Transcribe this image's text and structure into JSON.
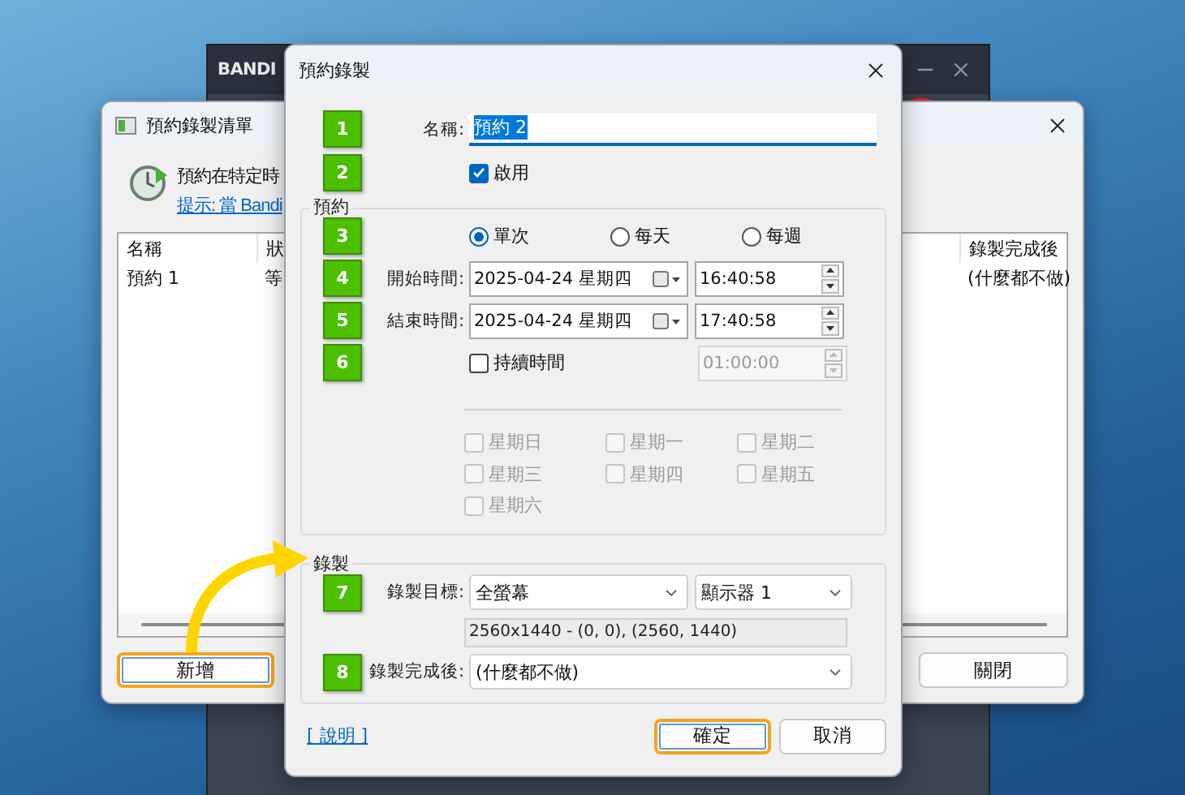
{
  "background_app": {
    "title_fragment": "BANDI"
  },
  "list_window": {
    "title": "預約錄製清單",
    "description": "預約在特定時",
    "tip_link": "提示: 當 Bandi",
    "columns": [
      "名稱",
      "狀",
      "錄製完成後"
    ],
    "rows": [
      {
        "cells": [
          "預約 1",
          "等",
          "(什麼都不做)"
        ]
      }
    ],
    "buttons": [
      {
        "label": "新增",
        "highlighted": true
      },
      {
        "label": "關閉",
        "highlighted": false
      }
    ]
  },
  "dialog": {
    "title": "預約錄製",
    "name": {
      "step": "1",
      "label": "名稱:",
      "value": "預約 2",
      "text_selected": true
    },
    "enable": {
      "step": "2",
      "label": "啟用",
      "checked": true
    },
    "schedule_group": {
      "title": "預約",
      "repeat_step": "3",
      "repeat_options": [
        {
          "label": "單次",
          "selected": true
        },
        {
          "label": "每天",
          "selected": false
        },
        {
          "label": "每週",
          "selected": false
        }
      ],
      "start": {
        "step": "4",
        "label": "開始時間:",
        "date": "2025-04-24 星期四",
        "time": "16:40:58"
      },
      "end": {
        "step": "5",
        "label": "結束時間:",
        "date": "2025-04-24 星期四",
        "time": "17:40:58"
      },
      "duration": {
        "step": "6",
        "label": "持續時間",
        "checked": false,
        "time": "01:00:00",
        "disabled": true
      },
      "weekdays": [
        {
          "label": "星期日",
          "checked": false,
          "disabled": true
        },
        {
          "label": "星期一",
          "checked": false,
          "disabled": true
        },
        {
          "label": "星期二",
          "checked": false,
          "disabled": true
        },
        {
          "label": "星期三",
          "checked": false,
          "disabled": true
        },
        {
          "label": "星期四",
          "checked": false,
          "disabled": true
        },
        {
          "label": "星期五",
          "checked": false,
          "disabled": true
        },
        {
          "label": "星期六",
          "checked": false,
          "disabled": true
        }
      ]
    },
    "recording_group": {
      "title": "錄製",
      "target": {
        "step": "7",
        "label": "錄製目標:",
        "mode": "全螢幕",
        "monitor": "顯示器 1",
        "resolution": "2560x1440 - (0, 0), (2560, 1440)"
      },
      "after": {
        "step": "8",
        "label": "錄製完成後:",
        "value": "(什麼都不做)"
      }
    },
    "help_link": "[ 說明 ]",
    "buttons": [
      {
        "label": "確定",
        "highlighted": true
      },
      {
        "label": "取消",
        "highlighted": false
      }
    ]
  }
}
